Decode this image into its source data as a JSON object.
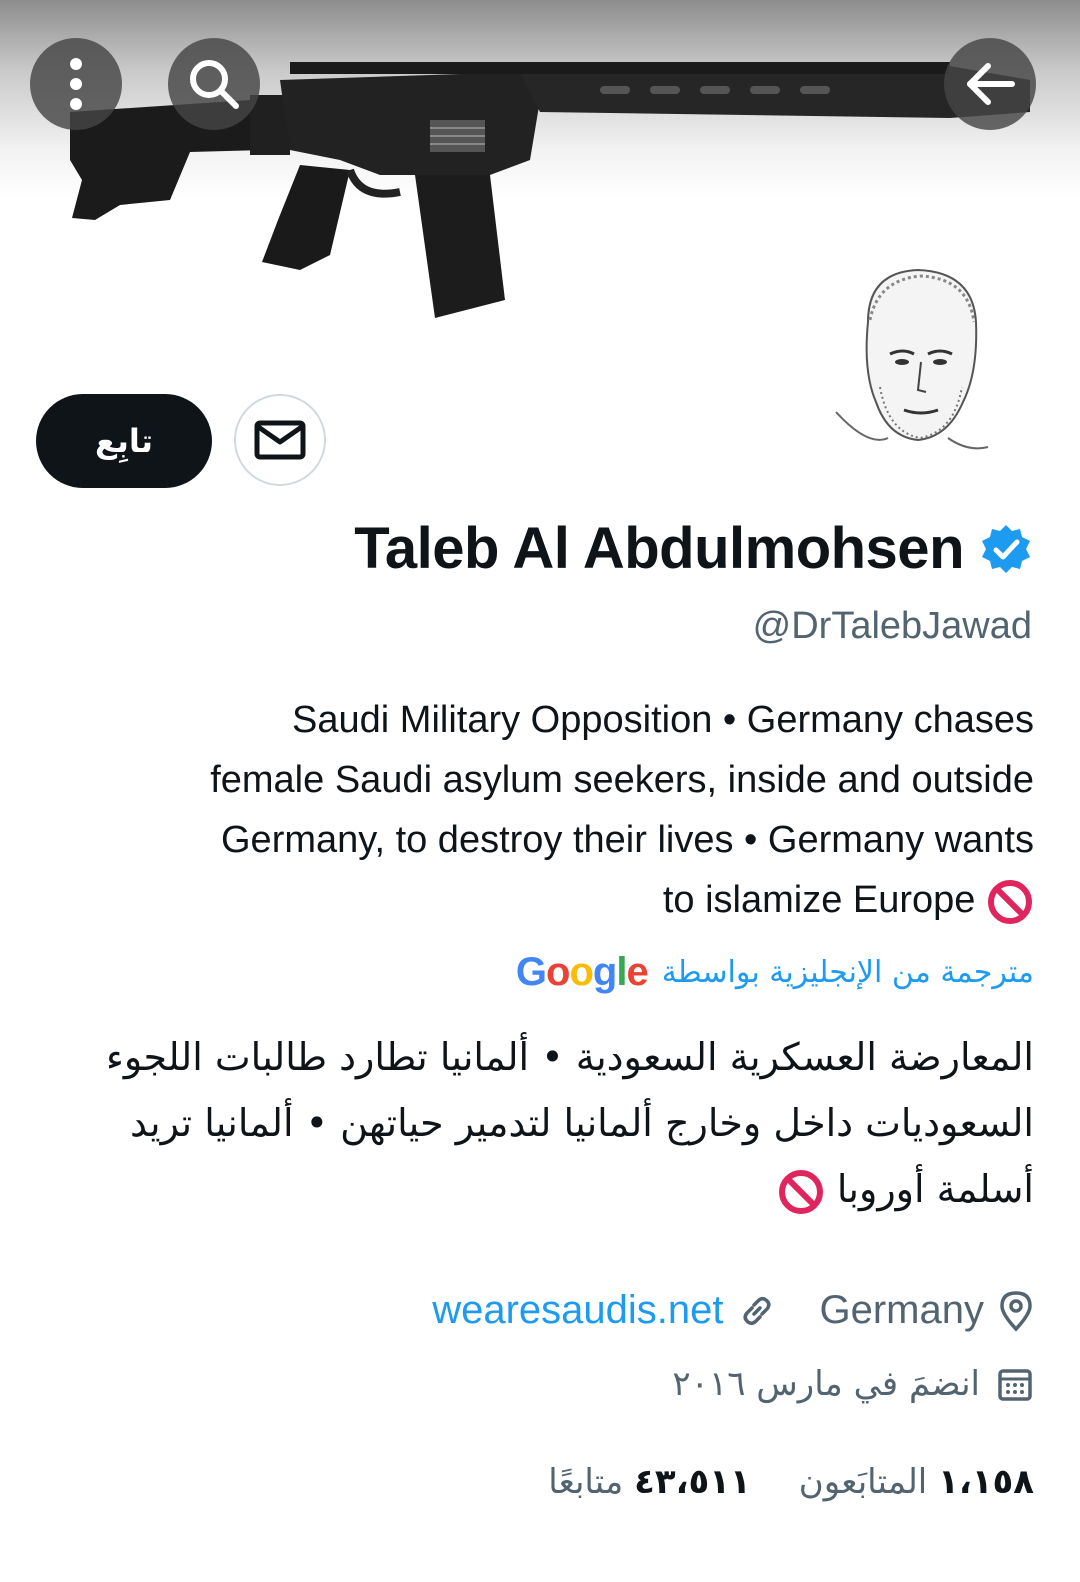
{
  "header": {
    "back_icon": "arrow-left-icon",
    "search_icon": "search-icon",
    "more_icon": "more-vertical-icon"
  },
  "profile": {
    "name": "Taleb Al Abdulmohsen",
    "verified_icon": "verified-badge-icon",
    "handle": "@DrTalebJawad",
    "follow_label": "تابِع",
    "message_icon": "mail-icon",
    "bio_en_1": "Saudi Military Opposition • Germany chases",
    "bio_en_2": "female Saudi asylum seekers, inside and outside",
    "bio_en_3": "Germany, to destroy their lives • Germany wants",
    "bio_en_4": "to islamize Europe",
    "translated_label": "مترجمة من الإنجليزية بواسطة",
    "translated_brand": "Google",
    "bio_ar_1": "المعارضة العسكرية السعودية • ألمانيا تطارد طالبات اللجوء",
    "bio_ar_2": "السعوديات داخل وخارج ألمانيا لتدمير حياتهن • ألمانيا تريد",
    "bio_ar_3": "أسلمة أوروبا",
    "location": "Germany",
    "website": "wearesaudis.net",
    "joined": "انضمَ في مارس ٢٠١٦",
    "following_count": "١،١٥٨",
    "following_label": "المتابَعون",
    "followers_count": "٤٣،٥١١",
    "followers_label": "متابعًا"
  },
  "colors": {
    "accent": "#1d9bf0",
    "muted": "#536471",
    "prohibited": "#e0245e"
  }
}
